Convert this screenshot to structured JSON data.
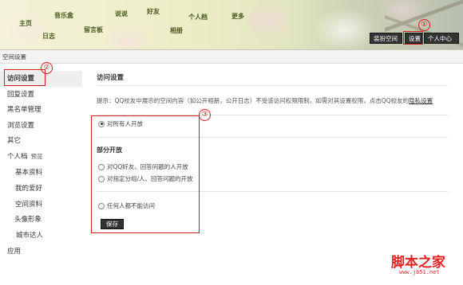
{
  "header": {
    "nav": {
      "home": "主页",
      "blog": "日志",
      "music": "音乐盒",
      "message": "留言板",
      "say": "说说",
      "friends": "好友",
      "album": "相册",
      "profile": "个人档",
      "more": "更多"
    },
    "buttons": {
      "decorate": "装扮空间",
      "settings": "设置",
      "center": "个人中心"
    }
  },
  "breadcrumb": "空间设置",
  "sidebar": {
    "items": [
      {
        "label": "访问设置"
      },
      {
        "label": "回复设置"
      },
      {
        "label": "黑名单管理"
      },
      {
        "label": "浏览设置"
      },
      {
        "label": "其它"
      },
      {
        "label": "个人档",
        "tag": "预览"
      },
      {
        "label": "基本资料"
      },
      {
        "label": "我的爱好"
      },
      {
        "label": "空间资料"
      },
      {
        "label": "头像形象"
      },
      {
        "label": "城市达人"
      },
      {
        "label": "应用"
      }
    ]
  },
  "main": {
    "title": "访问设置",
    "hint_prefix": "提示：QQ校友中展示的空间内容（如公开相册，公开日志）不受该访问权限限制，如需对其设置权限，点击QQ校友的",
    "hint_link": "隐私设置",
    "option_all": "对所有人开放",
    "section_partial": "部分开放",
    "option_qq_friends": "对QQ好友、回答问题的人开放",
    "option_groups": "对指定分组/人、回答问题的开放",
    "option_none": "任何人都不能访问",
    "save": "保存"
  },
  "annotations": {
    "one": "①",
    "two": "②",
    "three": "③"
  },
  "watermark": {
    "main": "脚本之家",
    "sub": "www.jb51.net"
  },
  "colors": {
    "annotation_red": "#d81e1e",
    "watermark_red": "#e02424",
    "button_dark": "#333333"
  }
}
